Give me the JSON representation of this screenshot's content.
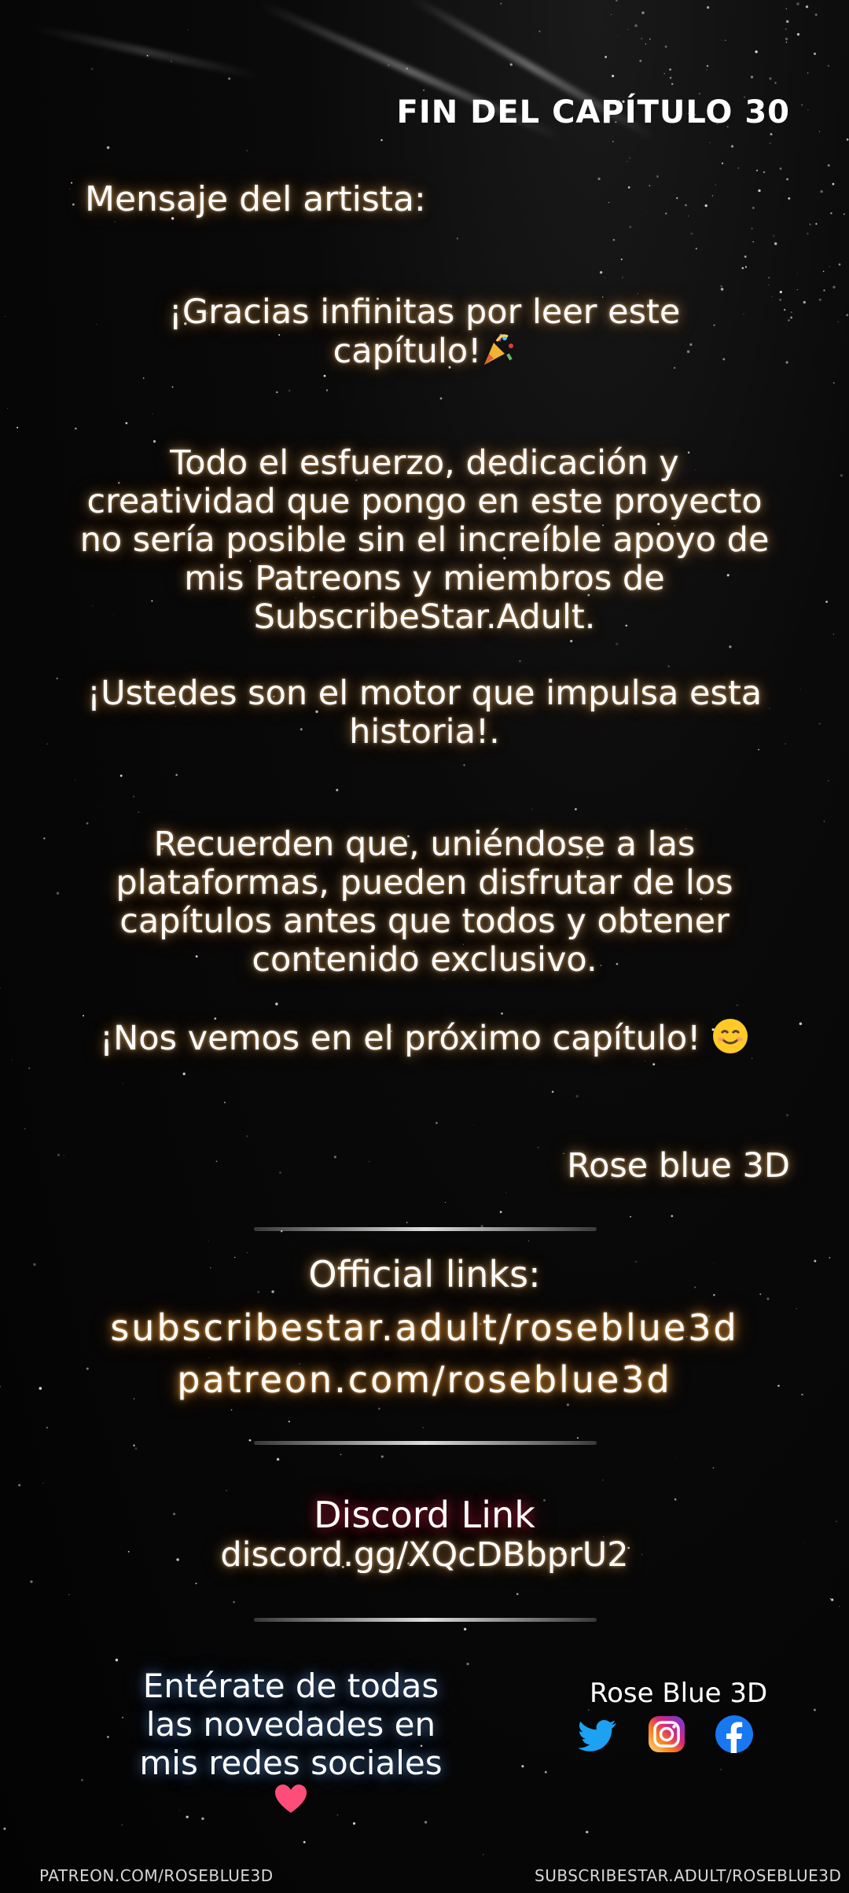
{
  "chapter_end": "FIN DEL CAPÍTULO 30",
  "artist_message_label": "Mensaje del artista:",
  "thanks_lines": [
    "¡Gracias infinitas por leer este",
    "capítulo!"
  ],
  "effort_lines": [
    "Todo el esfuerzo, dedicación y",
    "creatividad que pongo en este proyecto",
    "no sería posible sin el increíble apoyo de",
    "mis Patreons y miembros de",
    "SubscribeStar.Adult."
  ],
  "motor_lines": [
    "¡Ustedes son el motor que impulsa esta",
    "historia!."
  ],
  "remember_lines": [
    "Recuerden que, uniéndose a las",
    "plataformas, pueden disfrutar de los",
    "capítulos antes que todos y obtener",
    "contenido exclusivo."
  ],
  "see_you": "¡Nos vemos en el próximo capítulo!",
  "signature": "Rose blue 3D",
  "official_links_label": "Official links:",
  "links": [
    "subscribestar.adult/roseblue3d",
    "patreon.com/roseblue3d"
  ],
  "discord_label": "Discord Link",
  "discord_url": "discord.gg/XQcDBbprU2",
  "social_message_lines": [
    "Entérate de todas",
    "las novedades en",
    "mis redes sociales"
  ],
  "brand_name": "Rose Blue 3D",
  "social_icons": [
    "twitter-icon",
    "instagram-icon",
    "facebook-icon"
  ],
  "footer_left": "PATREON.COM/ROSEBLUE3D",
  "footer_right": "SUBSCRIBESTAR.ADULT/ROSEBLUE3D",
  "colors": {
    "glow_orange": "#ffa03c",
    "discord_glow": "#c81e3c",
    "social_glow": "#5a96ff",
    "twitter": "#1da1f2",
    "facebook": "#1877f2",
    "heart": "#ff4d79"
  }
}
